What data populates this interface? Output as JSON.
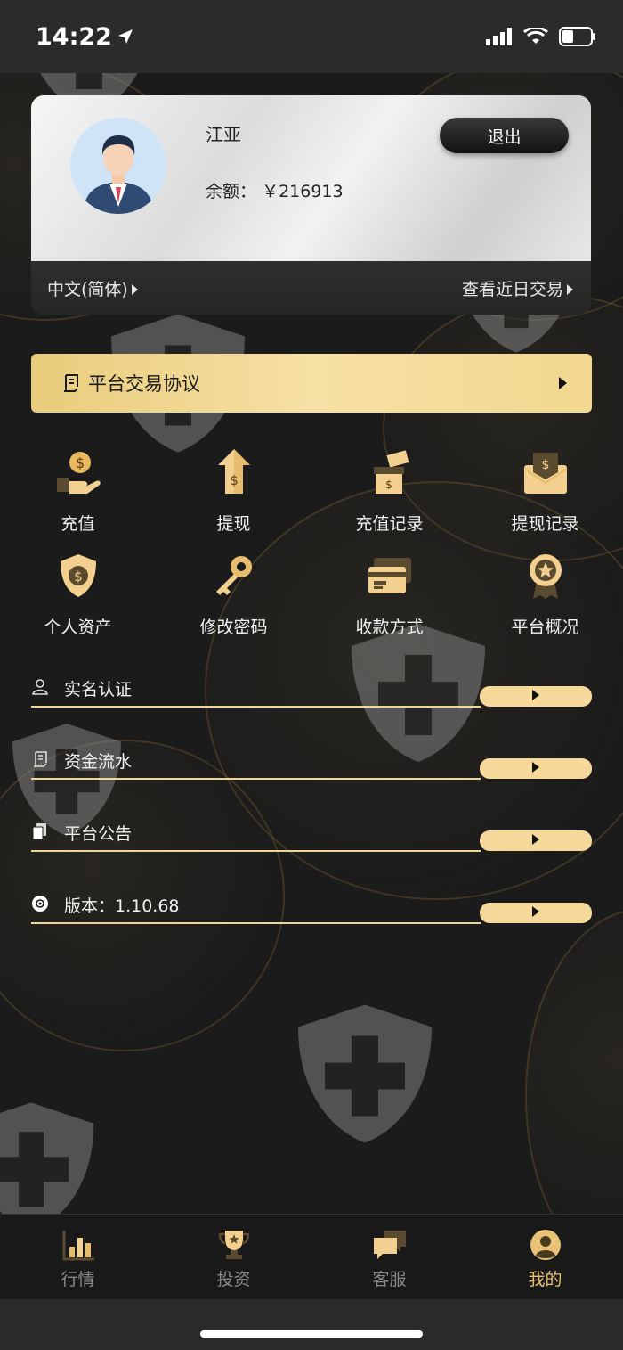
{
  "status_bar": {
    "time": "14:22"
  },
  "profile": {
    "name": "江亚",
    "balance_label": "余额：",
    "balance_value": "￥216913",
    "logout_label": "退出",
    "language_label": "中文(简体)",
    "recent_trades_label": "查看近日交易"
  },
  "agreement": {
    "label": "平台交易协议"
  },
  "grid": {
    "items": [
      {
        "label": "充值",
        "icon": "deposit-icon"
      },
      {
        "label": "提现",
        "icon": "withdraw-icon"
      },
      {
        "label": "充值记录",
        "icon": "deposit-record-icon"
      },
      {
        "label": "提现记录",
        "icon": "withdraw-record-icon"
      },
      {
        "label": "个人资产",
        "icon": "assets-shield-icon"
      },
      {
        "label": "修改密码",
        "icon": "key-icon"
      },
      {
        "label": "收款方式",
        "icon": "payment-card-icon"
      },
      {
        "label": "平台概况",
        "icon": "badge-star-icon"
      }
    ]
  },
  "list": {
    "items": [
      {
        "label": "实名认证",
        "icon": "user-icon"
      },
      {
        "label": "资金流水",
        "icon": "document-icon"
      },
      {
        "label": "平台公告",
        "icon": "notice-icon"
      },
      {
        "label": "版本：1.10.68",
        "icon": "version-icon"
      }
    ]
  },
  "tabbar": {
    "items": [
      {
        "label": "行情",
        "icon": "chart-bars-icon",
        "active": false
      },
      {
        "label": "投资",
        "icon": "trophy-icon",
        "active": false
      },
      {
        "label": "客服",
        "icon": "chat-icon",
        "active": false
      },
      {
        "label": "我的",
        "icon": "profile-icon",
        "active": true
      }
    ]
  },
  "colors": {
    "accent": "#e9c275",
    "gold_light": "#f6d99a",
    "background": "#1b1b1b"
  }
}
